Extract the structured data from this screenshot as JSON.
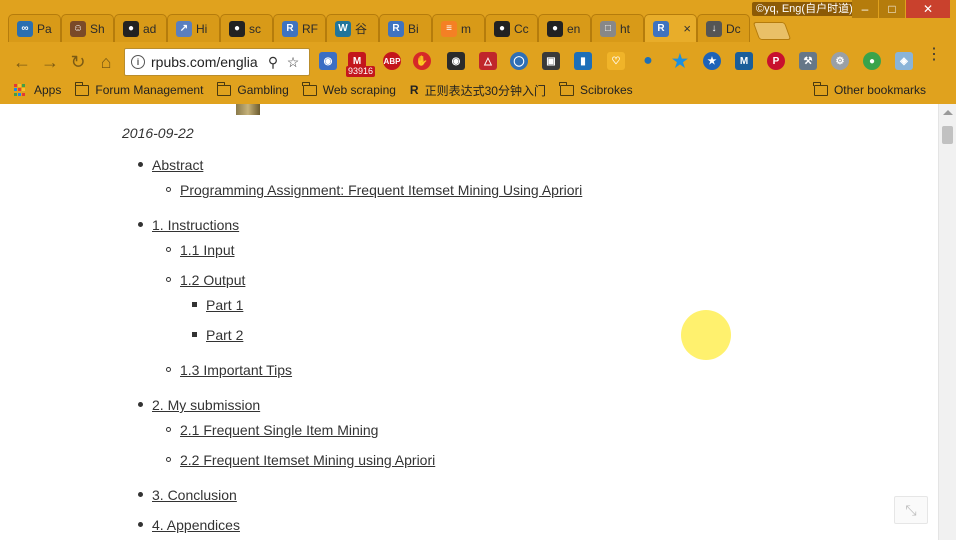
{
  "browser": {
    "tabs": [
      {
        "label": "Pa",
        "icon": "infinity-icon",
        "color": "#2a6fb0"
      },
      {
        "label": "Sh",
        "icon": "avatar-icon",
        "color": "#7a4a28"
      },
      {
        "label": "ad",
        "icon": "github-icon",
        "color": "#222222"
      },
      {
        "label": "Hi",
        "icon": "chart-icon",
        "color": "#5b7fbf"
      },
      {
        "label": "sc",
        "icon": "github-icon",
        "color": "#222222"
      },
      {
        "label": "RF",
        "icon": "r-icon",
        "color": "#3f73c0"
      },
      {
        "label": "⾕",
        "icon": "wordpress-icon",
        "color": "#21759b"
      },
      {
        "label": "Bi",
        "icon": "r-icon",
        "color": "#3f73c0"
      },
      {
        "label": "m",
        "icon": "stackoverflow-icon",
        "color": "#f48024"
      },
      {
        "label": "Cc",
        "icon": "github-icon",
        "color": "#222222"
      },
      {
        "label": "en",
        "icon": "github-icon",
        "color": "#222222"
      },
      {
        "label": "ht",
        "icon": "document-icon",
        "color": "#888888"
      },
      {
        "label": "",
        "icon": "r-icon",
        "color": "#3f73c0",
        "active": true
      },
      {
        "label": "Dc",
        "icon": "download-icon",
        "color": "#555555"
      }
    ],
    "profile_label": "©yq, Eng(自户时道)",
    "url": "rpubs.com/englia",
    "mail_badge": "93916",
    "extensions": [
      "ABP"
    ],
    "bookmarks": {
      "apps_label": "Apps",
      "items": [
        {
          "label": "Forum Management",
          "icon": "folder-icon"
        },
        {
          "label": "Gambling",
          "icon": "folder-icon"
        },
        {
          "label": "Web scraping",
          "icon": "folder-icon"
        },
        {
          "label": "正则表达式30分钟入门",
          "icon": "r-bookmark-icon"
        },
        {
          "label": "Scibrokes",
          "icon": "folder-icon"
        }
      ],
      "other_label": "Other bookmarks"
    },
    "accent_color": "#e0a21e"
  },
  "page": {
    "date": "2016-09-22",
    "toc": {
      "abstract": "Abstract",
      "abstract_sub": "Programming Assignment: Frequent Itemset Mining Using Apriori",
      "instructions": "1. Instructions",
      "input": "1.1 Input",
      "output": "1.2 Output",
      "part1": "Part 1",
      "part2": "Part 2",
      "tips": "1.3 Important Tips",
      "submission": "2. My submission",
      "single": "2.1 Frequent Single Item Mining",
      "itemset": "2.2 Frequent Itemset Mining using Apriori",
      "conclusion": "3. Conclusion",
      "appendices": "4. Appendices"
    }
  }
}
